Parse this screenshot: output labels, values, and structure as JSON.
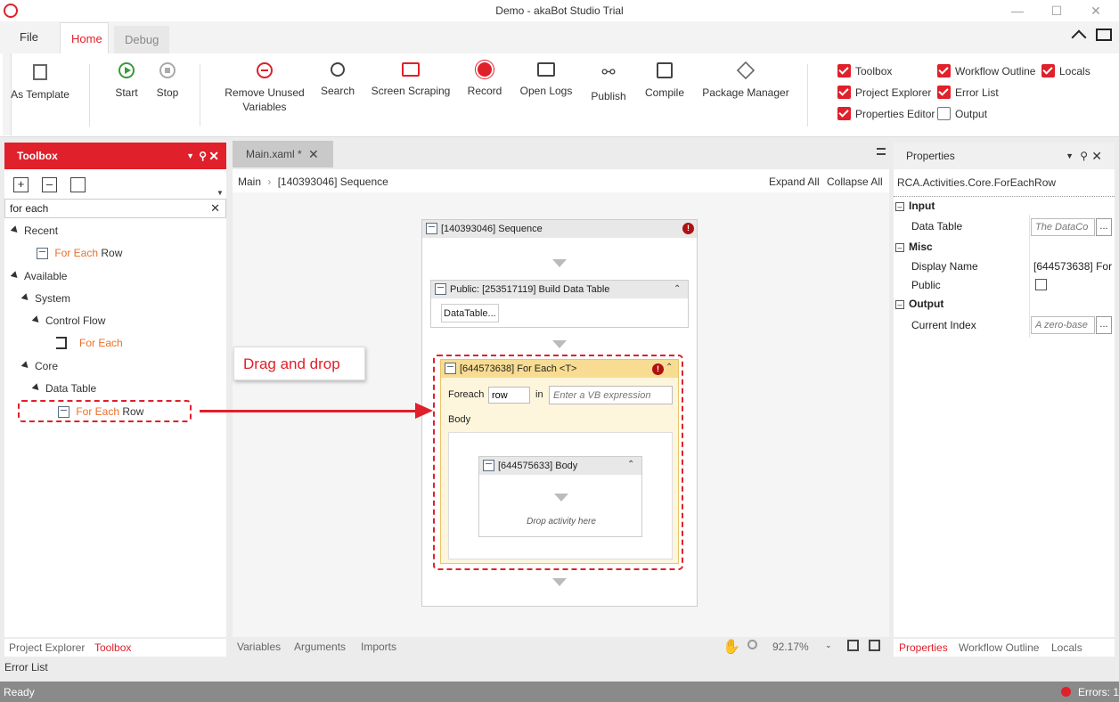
{
  "window": {
    "title": "Demo - akaBot Studio Trial"
  },
  "tabs": {
    "file": "File",
    "home": "Home",
    "debug": "Debug"
  },
  "ribbon": {
    "as_template": "As Template",
    "start": "Start",
    "stop": "Stop",
    "remove_unused_1": "Remove Unused",
    "remove_unused_2": "Variables",
    "search": "Search",
    "screen_scraping": "Screen Scraping",
    "record": "Record",
    "open_logs": "Open Logs",
    "publish": "Publish",
    "compile": "Compile",
    "package_manager": "Package Manager",
    "toggles": {
      "toolbox": "Toolbox",
      "workflow_outline": "Workflow Outline",
      "locals": "Locals",
      "project_explorer": "Project Explorer",
      "error_list": "Error List",
      "properties_editor": "Properties Editor",
      "output": "Output"
    }
  },
  "toolbox": {
    "title": "Toolbox",
    "search_value": "for each",
    "recent": "Recent",
    "recent_item_hl": "For Each",
    "recent_item_rest": " Row",
    "available": "Available",
    "system": "System",
    "control_flow": "Control Flow",
    "for_each": "For Each",
    "core": "Core",
    "data_table": "Data Table",
    "dt_item_hl": "For Each",
    "dt_item_rest": " Row",
    "bottom_tabs": {
      "project_explorer": "Project Explorer",
      "toolbox": "Toolbox"
    }
  },
  "designer": {
    "doc_tab": "Main.xaml *",
    "breadcrumb_root": "Main",
    "breadcrumb_current": "[140393046] Sequence",
    "expand_all": "Expand All",
    "collapse_all": "Collapse All",
    "sequence_title": "[140393046] Sequence",
    "build_dt_title": "Public: [253517119] Build Data Table",
    "build_dt_button": "DataTable...",
    "foreach_title": "[644573638] For Each <T>",
    "foreach_label": "Foreach",
    "foreach_var": "row",
    "in_label": "in",
    "in_placeholder": "Enter a VB expression",
    "body_label": "Body",
    "body_title": "[644575633] Body",
    "drop_hint": "Drop activity here",
    "bottom": {
      "variables": "Variables",
      "arguments": "Arguments",
      "imports": "Imports",
      "zoom": "92.17%"
    }
  },
  "annotation": {
    "text": "Drag and drop",
    "color": "#e0202a"
  },
  "properties": {
    "title": "Properties",
    "type_name": "RCA.Activities.Core.ForEachRow",
    "input": "Input",
    "data_table_label": "Data Table",
    "data_table_placeholder": "The DataCo",
    "misc": "Misc",
    "display_name_label": "Display Name",
    "display_name_value": "[644573638] For",
    "public_label": "Public",
    "output": "Output",
    "current_index_label": "Current Index",
    "current_index_placeholder": "A zero-base",
    "bottom_tabs": {
      "properties": "Properties",
      "workflow_outline": "Workflow Outline",
      "locals": "Locals"
    }
  },
  "error_list_tab": "Error List",
  "status": {
    "text": "Ready",
    "errors": "Errors: 1"
  }
}
